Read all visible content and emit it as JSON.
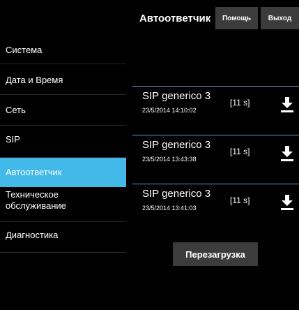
{
  "header": {
    "title": "Автоответчик",
    "help_label": "Помощь",
    "exit_label": "Выход"
  },
  "sidebar": {
    "items": [
      {
        "label": "Система",
        "active": false
      },
      {
        "label": "Дата и Время",
        "active": false
      },
      {
        "label": "Сеть",
        "active": false
      },
      {
        "label": "SIP",
        "active": false
      },
      {
        "label": "Автоответчик",
        "active": true
      },
      {
        "label": "Техническое обслуживание",
        "active": false
      },
      {
        "label": "Диагностика",
        "active": false
      }
    ]
  },
  "messages": [
    {
      "name": "SIP generico 3",
      "date": "23/5/2014 14:10:02",
      "duration": "[11 s]",
      "icon": "download-icon"
    },
    {
      "name": "SIP generico 3",
      "date": "23/5/2014 13:43:38",
      "duration": "[11 s]",
      "icon": "download-icon"
    },
    {
      "name": "SIP generico 3",
      "date": "23/5/2014 13:41:03",
      "duration": "[11 s]",
      "icon": "download-icon"
    }
  ],
  "reboot_label": "Перезагрузка",
  "colors": {
    "background": "#000000",
    "active": "#43b9e9",
    "button": "#3c3c3c",
    "separator": "#5aa0c8"
  }
}
